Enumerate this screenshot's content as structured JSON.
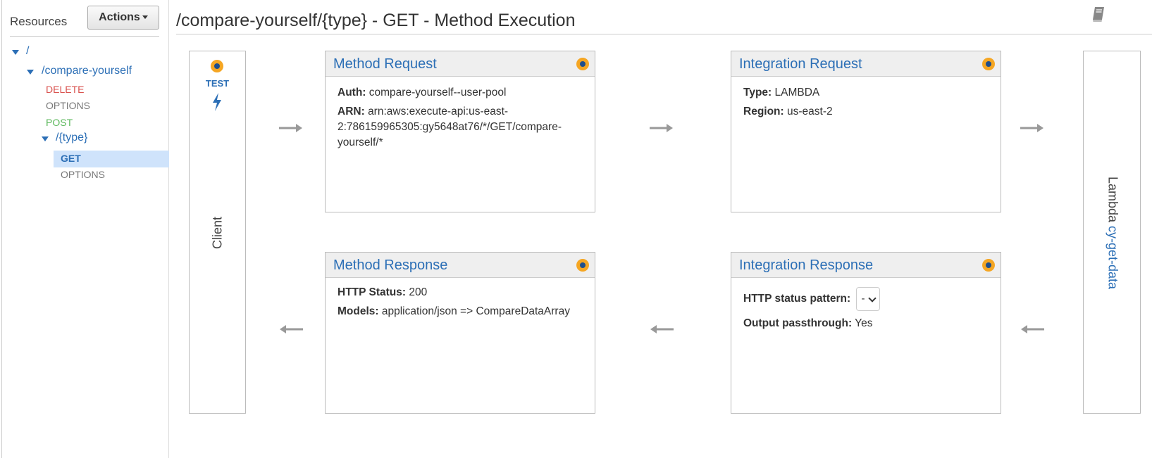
{
  "sidebar": {
    "title": "Resources",
    "actions_label": "Actions",
    "tree": {
      "root": "/",
      "resource": "/compare-yourself",
      "methods": [
        "DELETE",
        "OPTIONS",
        "POST"
      ],
      "child": "/{type}",
      "child_methods": [
        "GET",
        "OPTIONS"
      ],
      "selected": "GET"
    }
  },
  "page": {
    "title": "/compare-yourself/{type} - GET - Method Execution"
  },
  "client": {
    "test_label": "TEST",
    "label": "Client"
  },
  "method_request": {
    "title": "Method Request",
    "auth_key": "Auth:",
    "auth_value": "compare-yourself--user-pool",
    "arn_key": "ARN:",
    "arn_value_l1": "arn:aws:execute-api:us-east-",
    "arn_value_l2": "2:786159965305:gy5648at76/*/GET/compare-",
    "arn_value_l3": "yourself/*"
  },
  "integration_request": {
    "title": "Integration Request",
    "type_key": "Type:",
    "type_value": "LAMBDA",
    "region_key": "Region:",
    "region_value": "us-east-2"
  },
  "method_response": {
    "title": "Method Response",
    "status_key": "HTTP Status:",
    "status_value": "200",
    "models_key": "Models:",
    "models_value": "application/json => CompareDataArray"
  },
  "integration_response": {
    "title": "Integration Response",
    "pattern_key": "HTTP status pattern:",
    "pattern_value": "-",
    "passthrough_key": "Output passthrough:",
    "passthrough_value": "Yes"
  },
  "lambda": {
    "label": "Lambda",
    "function": "cy-get-data"
  },
  "colors": {
    "link": "#2c6fb6",
    "delete": "#d9534f",
    "post": "#5cb85c",
    "status_dot": "#f5a623"
  },
  "icons": [
    "caret-down-icon",
    "book-icon",
    "status-dot-icon",
    "lightning-bolt-icon",
    "arrow-right-icon",
    "arrow-left-icon",
    "chevron-down-icon"
  ]
}
